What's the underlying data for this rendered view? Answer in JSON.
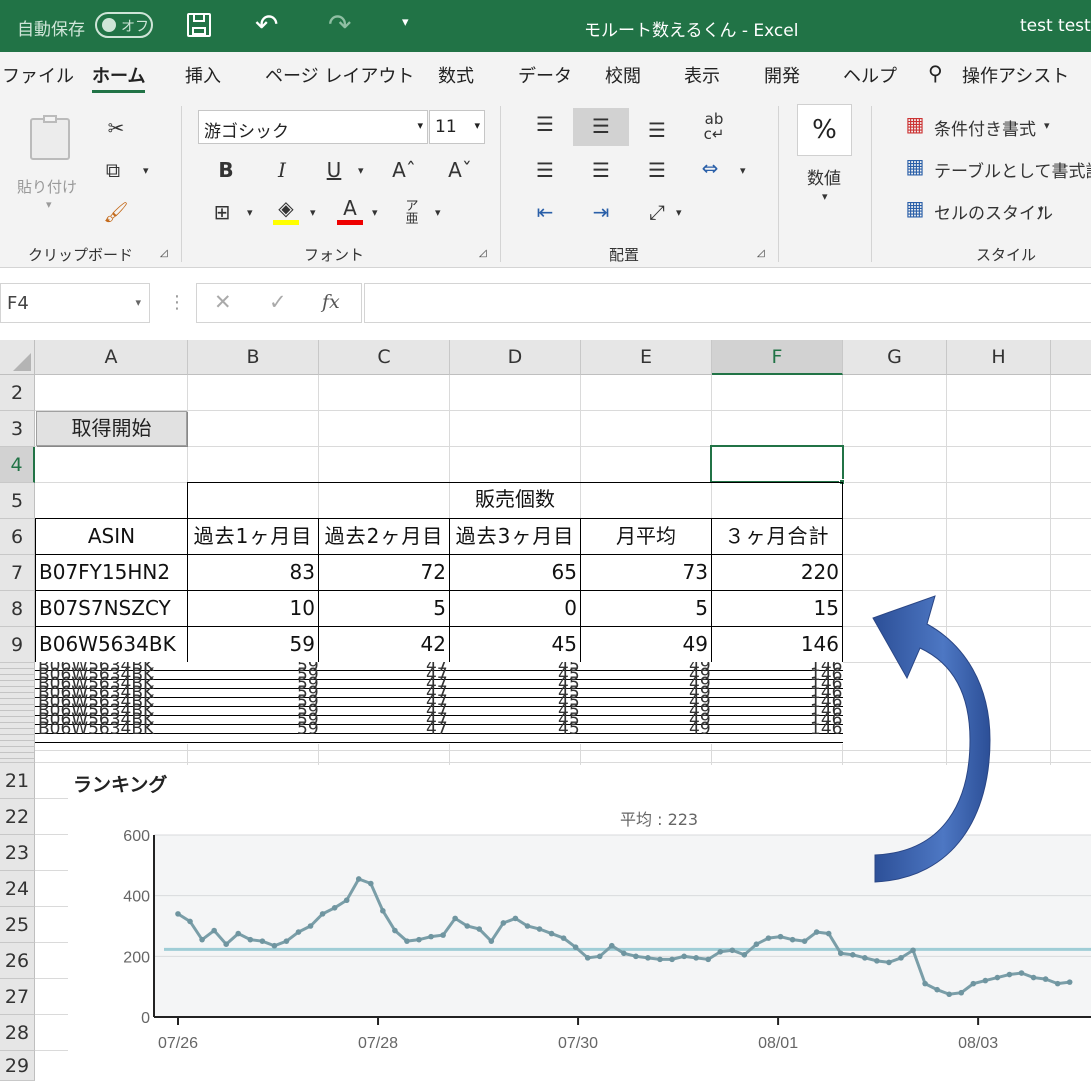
{
  "titlebar": {
    "autosave_label": "自動保存",
    "autosave_state": "オフ",
    "doc_title": "モルート数えるくん  -  Excel",
    "user": "test test"
  },
  "tabs": [
    "ファイル",
    "ホーム",
    "挿入",
    "ページ レイアウト",
    "数式",
    "データ",
    "校閲",
    "表示",
    "開発",
    "ヘルプ",
    "操作アシスト"
  ],
  "active_tab": "ホーム",
  "ribbon": {
    "clipboard": {
      "paste": "貼り付け",
      "group": "クリップボード"
    },
    "font": {
      "name": "游ゴシック",
      "size": "11",
      "group": "フォント"
    },
    "alignment": {
      "group": "配置"
    },
    "number": {
      "label": "数値",
      "group": ""
    },
    "styles": {
      "conditional": "条件付き書式",
      "table": "テーブルとして書式設定",
      "cell": "セルのスタイル",
      "group": "スタイル"
    }
  },
  "formula_bar": {
    "name_box": "F4",
    "fx": "fx",
    "value": ""
  },
  "columns": [
    "A",
    "B",
    "C",
    "D",
    "E",
    "F",
    "G",
    "H"
  ],
  "rows": [
    "2",
    "3",
    "4",
    "5",
    "6",
    "7",
    "8",
    "9",
    "21",
    "22",
    "23",
    "24",
    "25",
    "26",
    "27",
    "28",
    "29"
  ],
  "sheet": {
    "button": "取得開始",
    "header_group": "販売個数",
    "headers": [
      "ASIN",
      "過去1ヶ月目",
      "過去2ヶ月目",
      "過去3ヶ月目",
      "月平均",
      "３ヶ月合計"
    ],
    "data": [
      [
        "B07FY15HN2",
        "83",
        "72",
        "65",
        "73",
        "220"
      ],
      [
        "B07S7NSZCY",
        "10",
        "5",
        "0",
        "5",
        "15"
      ],
      [
        "B06W5634BK",
        "59",
        "42",
        "45",
        "49",
        "146"
      ]
    ],
    "hidden_repeat": [
      "B06W5634BK",
      "59",
      "47",
      "45",
      "49",
      "146"
    ]
  },
  "accent_colors": {
    "excel_green": "#217346",
    "arrow": "#3b5ea8",
    "line": "#7a9ea8",
    "avg_line": "#9fcdd6"
  },
  "chart_data": {
    "type": "line",
    "title": "ランキング",
    "subtitle": "平均 : 223",
    "average": 223,
    "ylim": [
      0,
      600
    ],
    "yticks": [
      "600",
      "400",
      "200",
      "0"
    ],
    "xticks": [
      "07/26",
      "07/28",
      "07/30",
      "08/01",
      "08/03"
    ],
    "grid": true,
    "series": [
      {
        "values": [
          340,
          315,
          255,
          285,
          240,
          275,
          255,
          250,
          235,
          250,
          280,
          300,
          340,
          360,
          385,
          455,
          440,
          350,
          285,
          250,
          255,
          265,
          270,
          325,
          300,
          290,
          250,
          310,
          325,
          300,
          290,
          275,
          260,
          230,
          195,
          200,
          235,
          210,
          200,
          195,
          190,
          190,
          200,
          195,
          190,
          215,
          220,
          205,
          240,
          260,
          265,
          255,
          250,
          280,
          275,
          210,
          205,
          195,
          185,
          180,
          195,
          220,
          110,
          90,
          75,
          80,
          110,
          120,
          130,
          140,
          145,
          130,
          125,
          110,
          115
        ]
      }
    ]
  }
}
